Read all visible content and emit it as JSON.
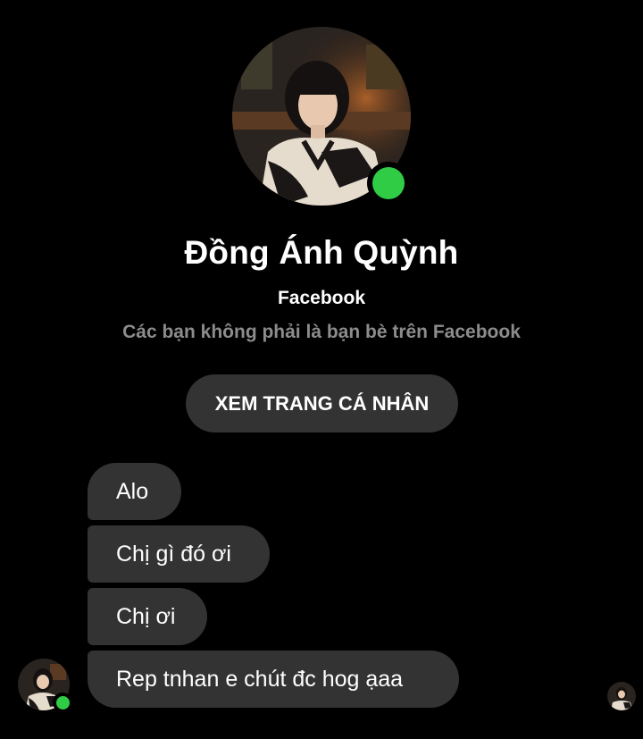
{
  "profile": {
    "name": "Đồng Ánh Quỳnh",
    "platform": "Facebook",
    "relation": "Các bạn không phải là bạn bè trên Facebook",
    "online": true,
    "status_color": "#31cc46"
  },
  "actions": {
    "view_profile_label": "XEM TRANG CÁ NHÂN"
  },
  "messages": [
    {
      "text": "Alo"
    },
    {
      "text": "Chị gì đó ơi"
    },
    {
      "text": "Chị ơi"
    },
    {
      "text": "Rep tnhan e chút đc hog ạaa"
    }
  ],
  "theme": {
    "background": "#000000",
    "bubble": "#333333",
    "secondary_text": "#8c8c8c"
  }
}
